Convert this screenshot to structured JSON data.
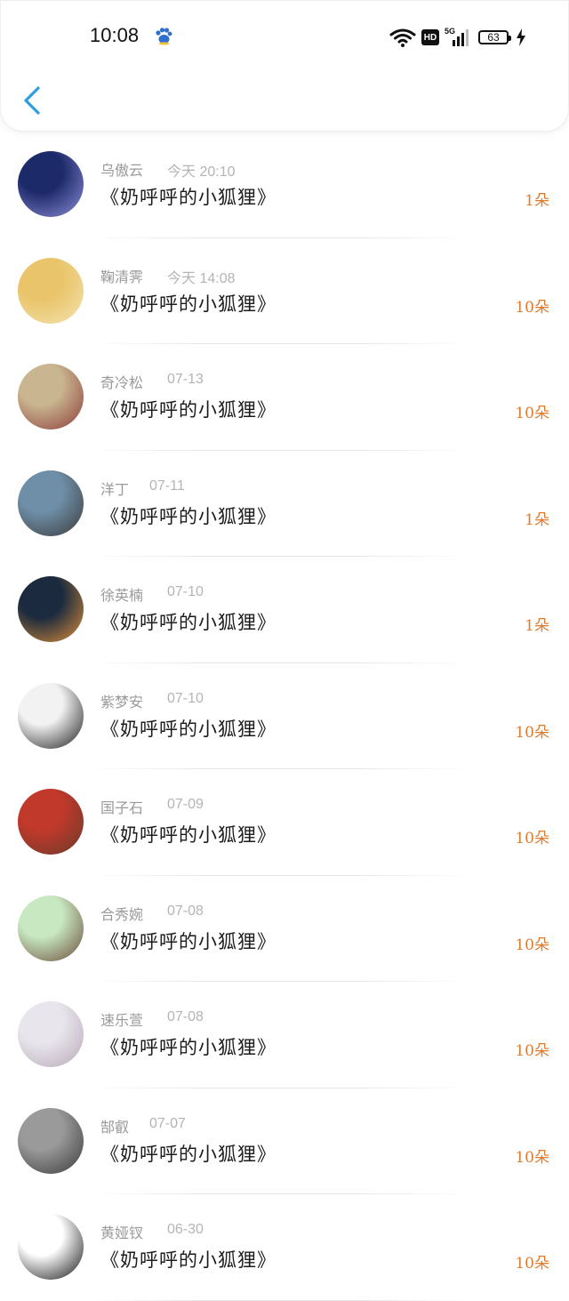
{
  "status_bar": {
    "time": "10:08",
    "network_badge": "HD",
    "network_type": "5G",
    "battery": "63"
  },
  "header": {
    "back_icon": "chevron-left-icon"
  },
  "colors": {
    "accent": "#2d9fe0",
    "count": "#e07b2e",
    "name": "#9a9a9a"
  },
  "list": [
    {
      "name": "乌傲云",
      "time": "今天 20:10",
      "title": "《奶呼呼的小狐狸》",
      "count": "1朵",
      "avatar_colors": [
        "#1d2a6a",
        "#8f8fd8"
      ]
    },
    {
      "name": "鞠清霁",
      "time": "今天 14:08",
      "title": "《奶呼呼的小狐狸》",
      "count": "10朵",
      "avatar_colors": [
        "#e9c46a",
        "#f3e3b0"
      ]
    },
    {
      "name": "奇冷松",
      "time": "07-13",
      "title": "《奶呼呼的小狐狸》",
      "count": "10朵",
      "avatar_colors": [
        "#c9b58f",
        "#8b3a3a"
      ]
    },
    {
      "name": "洋丁",
      "time": "07-11",
      "title": "《奶呼呼的小狐狸》",
      "count": "1朵",
      "avatar_colors": [
        "#6f8fa8",
        "#3a3a3a"
      ]
    },
    {
      "name": "徐英楠",
      "time": "07-10",
      "title": "《奶呼呼的小狐狸》",
      "count": "1朵",
      "avatar_colors": [
        "#1b2a3e",
        "#e0913a"
      ]
    },
    {
      "name": "紫梦安",
      "time": "07-10",
      "title": "《奶呼呼的小狐狸》",
      "count": "10朵",
      "avatar_colors": [
        "#f2f2f2",
        "#1a1a1a"
      ]
    },
    {
      "name": "国子石",
      "time": "07-09",
      "title": "《奶呼呼的小狐狸》",
      "count": "10朵",
      "avatar_colors": [
        "#c0392b",
        "#6b3a2a"
      ]
    },
    {
      "name": "合秀婉",
      "time": "07-08",
      "title": "《奶呼呼的小狐狸》",
      "count": "10朵",
      "avatar_colors": [
        "#c7e8c0",
        "#6b4a3a"
      ]
    },
    {
      "name": "速乐萱",
      "time": "07-08",
      "title": "《奶呼呼的小狐狸》",
      "count": "10朵",
      "avatar_colors": [
        "#e8e6ec",
        "#b8a8b8"
      ]
    },
    {
      "name": "郜叡",
      "time": "07-07",
      "title": "《奶呼呼的小狐狸》",
      "count": "10朵",
      "avatar_colors": [
        "#9a9a9a",
        "#3a3a3a"
      ]
    },
    {
      "name": "黄娅钗",
      "time": "06-30",
      "title": "《奶呼呼的小狐狸》",
      "count": "10朵",
      "avatar_colors": [
        "#ffffff",
        "#111111"
      ]
    }
  ]
}
